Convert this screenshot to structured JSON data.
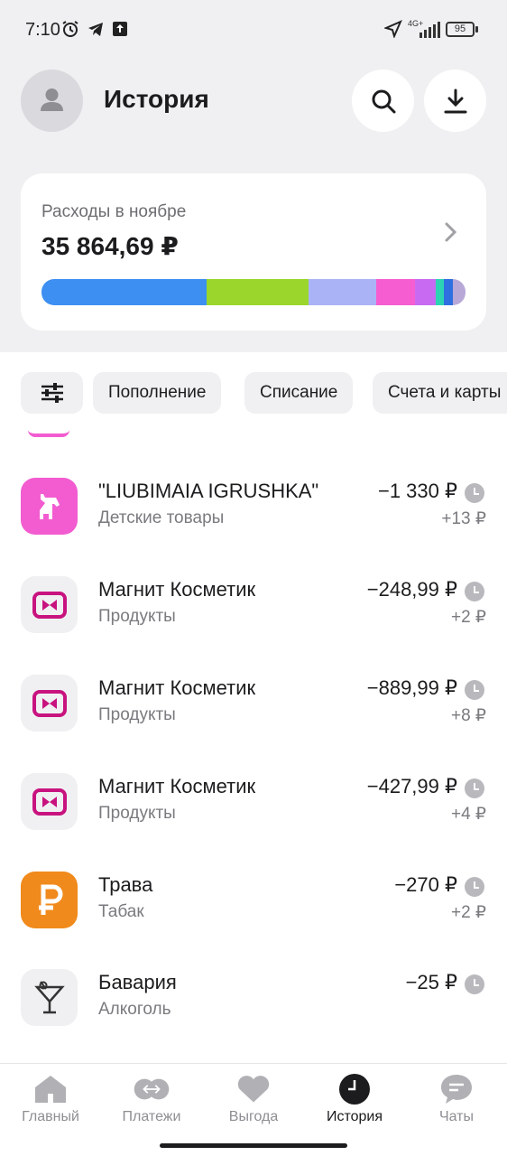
{
  "status_bar": {
    "time": "7:10",
    "network": "4G+",
    "battery": "95"
  },
  "header": {
    "title": "История"
  },
  "expenses": {
    "label": "Расходы в ноябре",
    "total": "35 864,69 ₽",
    "segments": [
      {
        "color": "#3d8ff2",
        "share": 0.39
      },
      {
        "color": "#9ad62b",
        "share": 0.24
      },
      {
        "color": "#aab3f5",
        "share": 0.16
      },
      {
        "color": "#f55dd1",
        "share": 0.09
      },
      {
        "color": "#c86bf2",
        "share": 0.05
      },
      {
        "color": "#2dd4b3",
        "share": 0.02
      },
      {
        "color": "#2f6fe0",
        "share": 0.02
      },
      {
        "color": "#b8a8d8",
        "share": 0.03
      }
    ]
  },
  "filters": [
    "Пополнение",
    "Списание",
    "Счета и карты"
  ],
  "transactions": [
    {
      "name": "\"LIUBIMAIA IGRUSHKA\"",
      "category": "Детские товары",
      "amount": "−1 330 ₽",
      "cashback": "+13 ₽",
      "icon": "horse-toy-icon",
      "color": "#f25cd0"
    },
    {
      "name": "Магнит Косметик",
      "category": "Продукты",
      "amount": "−248,99 ₽",
      "cashback": "+2 ₽",
      "icon": "magnit-cosmetic-logo",
      "color": "#c8137f"
    },
    {
      "name": "Магнит Косметик",
      "category": "Продукты",
      "amount": "−889,99 ₽",
      "cashback": "+8 ₽",
      "icon": "magnit-cosmetic-logo",
      "color": "#c8137f"
    },
    {
      "name": "Магнит Косметик",
      "category": "Продукты",
      "amount": "−427,99 ₽",
      "cashback": "+4 ₽",
      "icon": "magnit-cosmetic-logo",
      "color": "#c8137f"
    },
    {
      "name": "Трава",
      "category": "Табак",
      "amount": "−270 ₽",
      "cashback": "+2 ₽",
      "icon": "ruble-icon",
      "color": "#f08a1c"
    },
    {
      "name": "Бавария",
      "category": "Алкоголь",
      "amount": "−25 ₽",
      "cashback": "",
      "icon": "cocktail-icon",
      "color": "#333333"
    }
  ],
  "nav": [
    {
      "label": "Главный",
      "icon": "home-icon"
    },
    {
      "label": "Платежи",
      "icon": "payments-icon"
    },
    {
      "label": "Выгода",
      "icon": "heart-icon"
    },
    {
      "label": "История",
      "icon": "history-clock-icon",
      "active": true
    },
    {
      "label": "Чаты",
      "icon": "chat-icon"
    }
  ]
}
